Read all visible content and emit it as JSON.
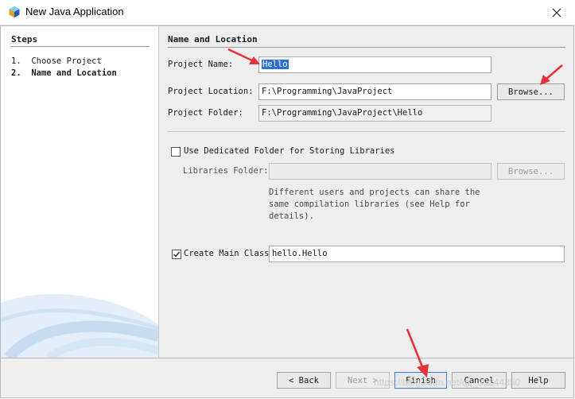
{
  "window": {
    "title": "New Java Application",
    "icon": "apache-netbeans-icon",
    "close_icon": "close-icon"
  },
  "steps": {
    "title": "Steps",
    "items": [
      {
        "number": "1.",
        "label": "Choose Project"
      },
      {
        "number": "2.",
        "label": "Name and Location"
      }
    ]
  },
  "main": {
    "title": "Name and Location",
    "project_name": {
      "label": "Project Name:",
      "value": "Hello"
    },
    "project_location": {
      "label": "Project Location:",
      "value": "F:\\Programming\\JavaProject"
    },
    "browse_label": "Browse...",
    "project_folder": {
      "label": "Project Folder:",
      "value": "F:\\Programming\\JavaProject\\Hello"
    },
    "dedicated_folder": {
      "label": "Use Dedicated Folder for Storing Libraries",
      "checked": false
    },
    "libraries_folder": {
      "label": "Libraries Folder:",
      "value": ""
    },
    "libraries_browse_label": "Browse...",
    "libraries_note": "Different users and projects can share the same compilation libraries (see Help for details).",
    "main_class": {
      "label": "Create Main Class",
      "checked": true,
      "value": "hello.Hello"
    }
  },
  "buttons": {
    "back": "< Back",
    "next": "Next >",
    "finish": "Finish",
    "cancel": "Cancel",
    "help": "Help"
  },
  "annotations": {
    "arrow_color": "#e8303a"
  },
  "watermark": "https://blog.csdn.net/qq_39244350"
}
